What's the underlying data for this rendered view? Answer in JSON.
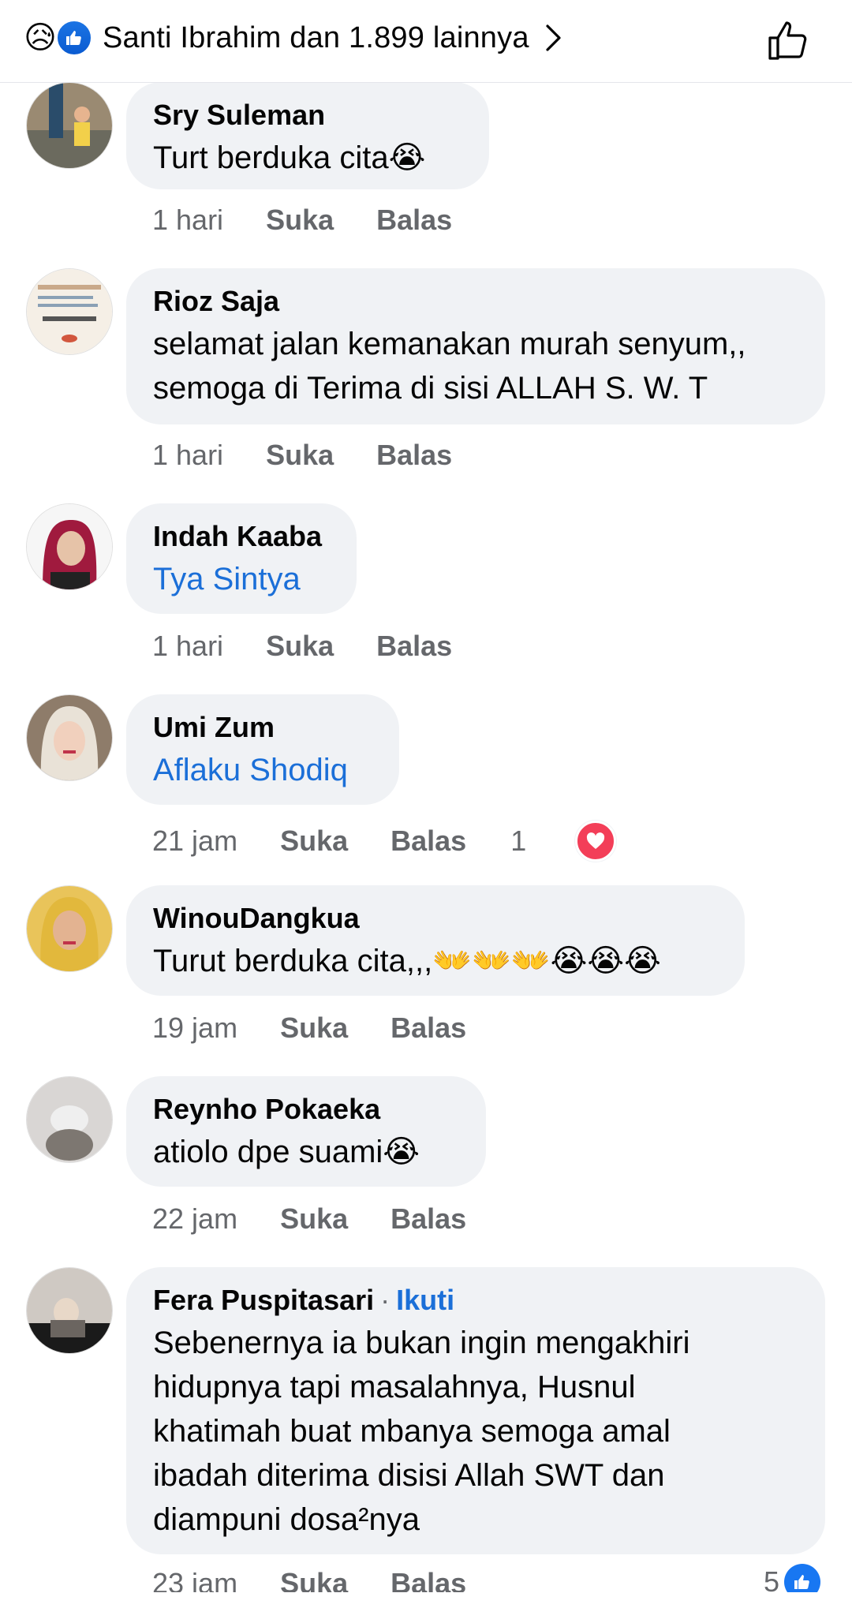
{
  "header": {
    "reactions_text": "Santi Ibrahim dan 1.899 lainnya",
    "reaction_icons": [
      "sad-face",
      "thumbs-up"
    ]
  },
  "comments": [
    {
      "author": "Sry Suleman",
      "text": "Turt berduka cita😭",
      "time": "1 hari",
      "like_label": "Suka",
      "reply_label": "Balas"
    },
    {
      "author": "Rioz Saja",
      "text": "selamat jalan kemanakan murah senyum,, semoga di Terima di sisi ALLAH S. W. T",
      "line1": "selamat jalan kemanakan murah senyum,,",
      "line2": "semoga di Terima di sisi ALLAH S. W. T",
      "time": "1 hari",
      "like_label": "Suka",
      "reply_label": "Balas"
    },
    {
      "author": "Indah Kaaba",
      "text": "Tya Sintya",
      "time": "1 hari",
      "like_label": "Suka",
      "reply_label": "Balas"
    },
    {
      "author": "Umi Zum",
      "text": "Aflaku Shodiq",
      "time": "21 jam",
      "like_label": "Suka",
      "reply_label": "Balas",
      "reaction_count": "1",
      "reaction_icon": "heart"
    },
    {
      "author": "WinouDangkua",
      "text": "Turut berduka cita,,,👐👐👐😭😭😭",
      "time": "19 jam",
      "like_label": "Suka",
      "reply_label": "Balas"
    },
    {
      "author": "Reynho Pokaeka",
      "text": "atiolo dpe suami😭",
      "time": "22 jam",
      "like_label": "Suka",
      "reply_label": "Balas"
    },
    {
      "author": "Fera Puspitasari",
      "follow_label": "Ikuti",
      "lines": [
        "Sebenernya ia bukan ingin mengakhiri",
        "hidupnya tapi masalahnya, Husnul",
        "khatimah buat mbanya semoga amal",
        "ibadah diterima disisi Allah SWT dan",
        "diampuni dosa²nya"
      ],
      "time": "23 jam",
      "like_label": "Suka",
      "reply_label": "Balas",
      "reaction_count": "5",
      "reaction_icon": "thumbs-up"
    }
  ],
  "colors": {
    "bubble": "#f0f2f5",
    "link": "#1b6fd8",
    "meta": "#65676b",
    "heart": "#f33e58",
    "like": "#1877f2"
  }
}
